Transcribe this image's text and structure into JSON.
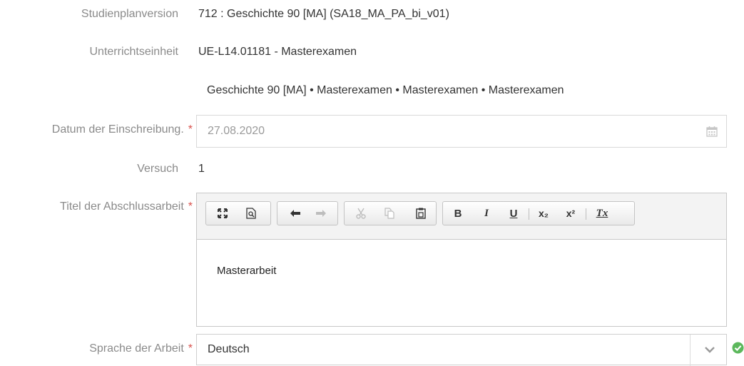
{
  "rows": {
    "studienplan": {
      "label": "Studienplanversion",
      "value": "712 : Geschichte 90 [MA] (SA18_MA_PA_bi_v01)"
    },
    "unterricht": {
      "label": "Unterrichtseinheit",
      "value": "UE-L14.01181 - Masterexamen",
      "path": "Geschichte 90 [MA] • Masterexamen • Masterexamen • Masterexamen"
    },
    "datum": {
      "label": "Datum der Einschreibung.",
      "required": "*",
      "value": "27.08.2020"
    },
    "versuch": {
      "label": "Versuch",
      "value": "1"
    },
    "titel": {
      "label": "Titel der Abschlussarbeit",
      "required": "*",
      "content": "Masterarbeit"
    },
    "sprache": {
      "label": "Sprache der Arbeit",
      "required": "*",
      "value": "Deutsch"
    }
  },
  "toolbar": {
    "bold": "B",
    "italic": "I",
    "underline": "U",
    "subscript": "x₂",
    "superscript": "x²",
    "remove_format": "Tx"
  },
  "colors": {
    "required": "#d9534f",
    "valid": "#5cb85c",
    "label": "#8a8a8a"
  },
  "icons": [
    "calendar-icon",
    "maximize-icon",
    "preview-icon",
    "undo-icon",
    "redo-icon",
    "cut-icon",
    "copy-icon",
    "paste-icon",
    "chevron-down-icon",
    "check-circle-icon"
  ]
}
